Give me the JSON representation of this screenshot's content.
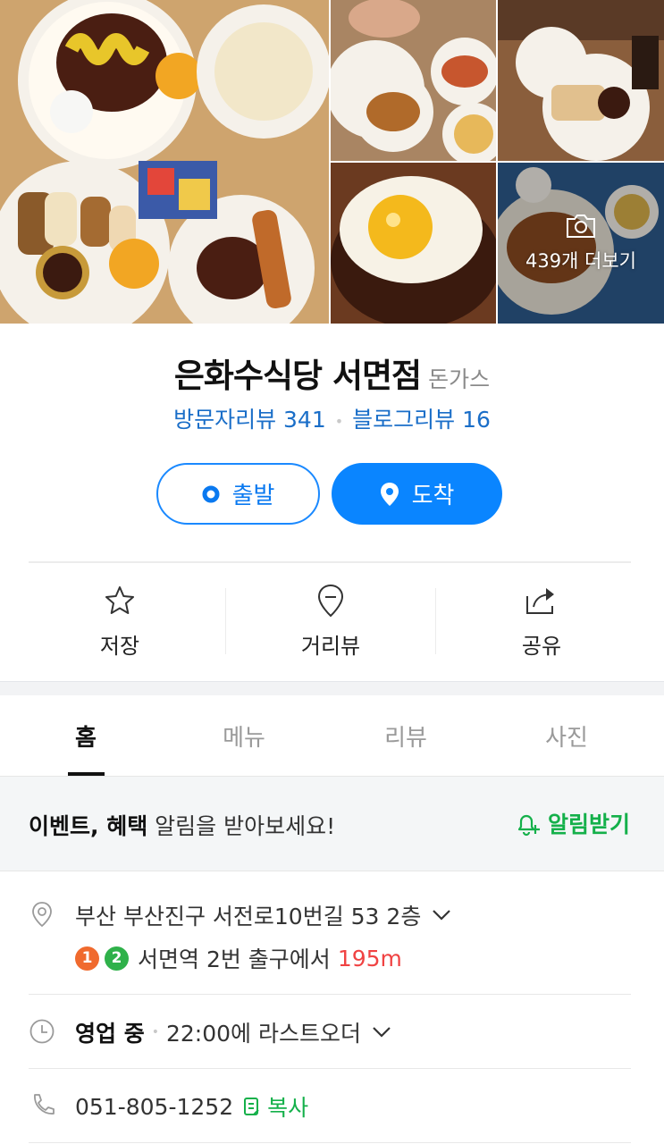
{
  "photos": {
    "more_label": "439개 더보기"
  },
  "place": {
    "name": "은화수식당 서면점",
    "category": "돈가스",
    "visitor_review": "방문자리뷰 341",
    "blog_review": "블로그리뷰 16"
  },
  "route": {
    "departure_label": "출발",
    "arrival_label": "도착"
  },
  "actions": {
    "save": "저장",
    "street_view": "거리뷰",
    "share": "공유"
  },
  "tabs": [
    "홈",
    "메뉴",
    "리뷰",
    "사진"
  ],
  "event": {
    "bold_text": "이벤트, 혜택",
    "text": " 알림을 받아보세요!",
    "notify_label": "알림받기"
  },
  "info": {
    "address": "부산 부산진구 서전로10번길 53 2층",
    "subway_lines": [
      "1",
      "2"
    ],
    "subway_text": "서면역 2번 출구에서",
    "subway_distance": "195m",
    "hours_status": "영업 중",
    "hours_text": "22:00에 라스트오더",
    "phone": "051-805-1252",
    "copy_label": "복사"
  },
  "colors": {
    "accent_blue": "#0a85ff",
    "review_blue": "#1a6ec8",
    "green": "#14b04a",
    "distance_red": "#f04343",
    "line1_orange": "#f06a2e",
    "line2_green": "#2fb14a"
  }
}
